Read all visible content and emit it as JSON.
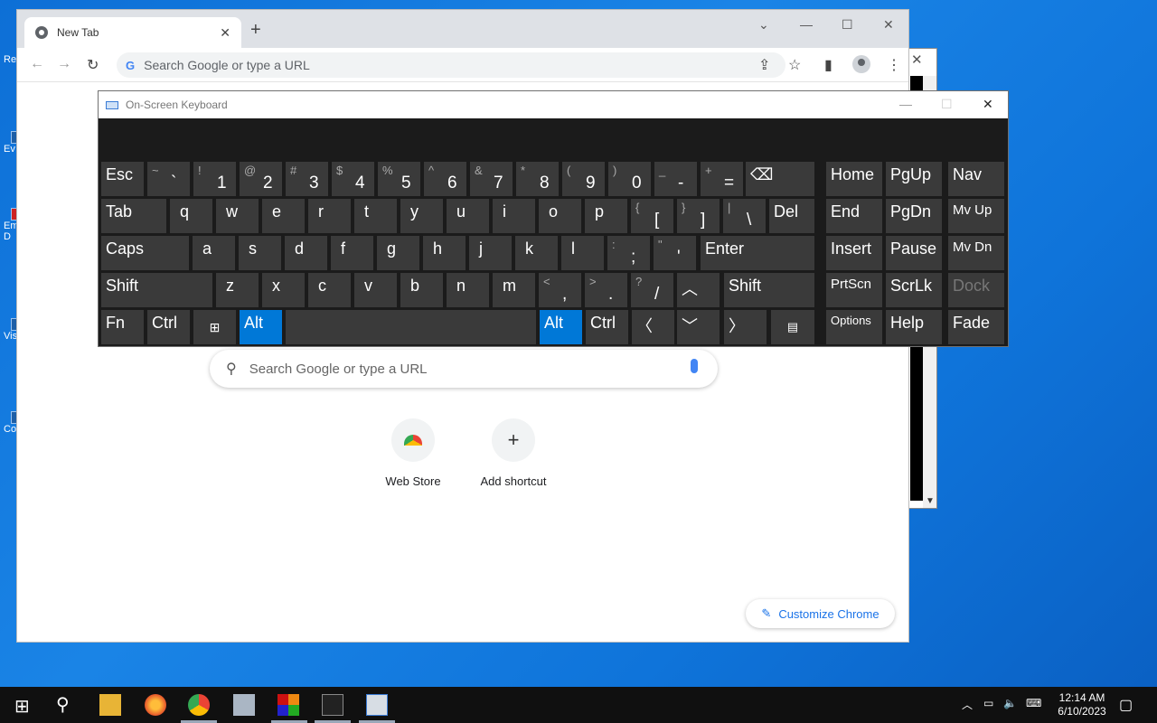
{
  "desktop": {
    "icons": [
      {
        "label": "Re"
      },
      {
        "label": "Ev"
      },
      {
        "label": "Em"
      },
      {
        "label": "D"
      },
      {
        "label": "Vis"
      },
      {
        "label": "Co"
      }
    ]
  },
  "chrome": {
    "tab_title": "New Tab",
    "omnibox_placeholder": "Search Google or type a URL",
    "ntp_search_placeholder": "Search Google or type a URL",
    "shortcuts": [
      {
        "label": "Web Store",
        "icon": "web-store-icon"
      },
      {
        "label": "Add shortcut",
        "icon": "plus-icon"
      }
    ],
    "customize_label": "Customize Chrome"
  },
  "osk": {
    "title": "On-Screen Keyboard",
    "keys": {
      "esc": "Esc",
      "tab": "Tab",
      "caps": "Caps",
      "shift": "Shift",
      "fn": "Fn",
      "ctrl": "Ctrl",
      "alt": "Alt",
      "del": "Del",
      "enter": "Enter",
      "shift_r": "Shift",
      "alt_r": "Alt",
      "ctrl_r": "Ctrl",
      "home": "Home",
      "pgup": "PgUp",
      "nav": "Nav",
      "end": "End",
      "pgdn": "PgDn",
      "mvup": "Mv Up",
      "insert": "Insert",
      "pause": "Pause",
      "mvdn": "Mv Dn",
      "prtscn": "PrtScn",
      "scrlk": "ScrLk",
      "dock": "Dock",
      "options": "Options",
      "help": "Help",
      "fade": "Fade"
    },
    "row1": [
      {
        "s": "~",
        "m": "`"
      },
      {
        "s": "!",
        "m": "1"
      },
      {
        "s": "@",
        "m": "2"
      },
      {
        "s": "#",
        "m": "3"
      },
      {
        "s": "$",
        "m": "4"
      },
      {
        "s": "%",
        "m": "5"
      },
      {
        "s": "^",
        "m": "6"
      },
      {
        "s": "&",
        "m": "7"
      },
      {
        "s": "*",
        "m": "8"
      },
      {
        "s": "(",
        "m": "9"
      },
      {
        "s": ")",
        "m": "0"
      },
      {
        "s": "_",
        "m": "-"
      },
      {
        "s": "+",
        "m": "="
      }
    ],
    "row2": [
      "q",
      "w",
      "e",
      "r",
      "t",
      "y",
      "u",
      "i",
      "o",
      "p"
    ],
    "row2_sym": [
      {
        "s": "{",
        "m": "["
      },
      {
        "s": "}",
        "m": "]"
      },
      {
        "s": "|",
        "m": "\\"
      }
    ],
    "row3": [
      "a",
      "s",
      "d",
      "f",
      "g",
      "h",
      "j",
      "k",
      "l"
    ],
    "row3_sym": [
      {
        "s": ":",
        "m": ";"
      },
      {
        "s": "\"",
        "m": "'"
      }
    ],
    "row4": [
      "z",
      "x",
      "c",
      "v",
      "b",
      "n",
      "m"
    ],
    "row4_sym": [
      {
        "s": "<",
        "m": ","
      },
      {
        "s": ">",
        "m": "."
      },
      {
        "s": "?",
        "m": "/"
      }
    ]
  },
  "taskbar": {
    "time": "12:14 AM",
    "date": "6/10/2023"
  }
}
